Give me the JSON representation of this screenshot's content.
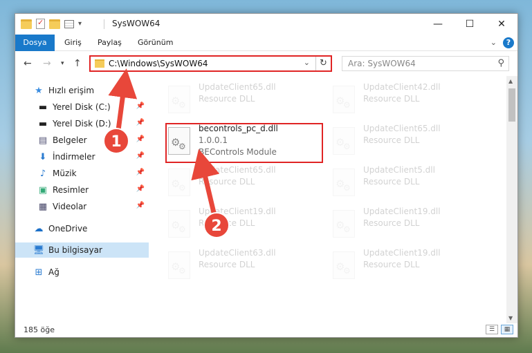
{
  "window": {
    "title": "SysWOW64"
  },
  "ribbon": {
    "tabs": [
      "Dosya",
      "Giriş",
      "Paylaş",
      "Görünüm"
    ]
  },
  "address": {
    "path": "C:\\Windows\\SysWOW64",
    "search_placeholder": "Ara: SysWOW64"
  },
  "sidebar": {
    "items": [
      {
        "label": "Hızlı erişim",
        "icon": "star-icon"
      },
      {
        "label": "Yerel Disk (C:)",
        "icon": "drive-icon",
        "pinned": true
      },
      {
        "label": "Yerel Disk (D:)",
        "icon": "drive-icon",
        "pinned": true
      },
      {
        "label": "Belgeler",
        "icon": "documents-icon",
        "pinned": true
      },
      {
        "label": "İndirmeler",
        "icon": "download-icon",
        "pinned": true
      },
      {
        "label": "Müzik",
        "icon": "music-icon",
        "pinned": true
      },
      {
        "label": "Resimler",
        "icon": "pictures-icon",
        "pinned": true
      },
      {
        "label": "Videolar",
        "icon": "videos-icon",
        "pinned": true
      },
      {
        "label": "OneDrive",
        "icon": "cloud-icon"
      },
      {
        "label": "Bu bilgisayar",
        "icon": "computer-icon",
        "selected": true
      },
      {
        "label": "Ağ",
        "icon": "network-icon"
      }
    ]
  },
  "files": [
    {
      "name": "UpdateClient65.dll",
      "line2": "Resource DLL",
      "faded": true
    },
    {
      "name": "UpdateClient42.dll",
      "line2": "Resource DLL",
      "faded": true
    },
    {
      "name": "becontrols_pc_d.dll",
      "line2": "1.0.0.1",
      "line3": "BEControls Module",
      "faded": false
    },
    {
      "name": "UpdateClient65.dll",
      "line2": "Resource DLL",
      "faded": true
    },
    {
      "name": "UpdateClient65.dll",
      "line2": "Resource DLL",
      "faded": true
    },
    {
      "name": "UpdateClient5.dll",
      "line2": "Resource DLL",
      "faded": true
    },
    {
      "name": "UpdateClient19.dll",
      "line2": "Resource DLL",
      "faded": true
    },
    {
      "name": "UpdateClient19.dll",
      "line2": "Resource DLL",
      "faded": true
    },
    {
      "name": "UpdateClient63.dll",
      "line2": "Resource DLL",
      "faded": true
    },
    {
      "name": "UpdateClient19.dll",
      "line2": "Resource DLL",
      "faded": true
    }
  ],
  "status": {
    "count": "185 öğe"
  },
  "annotations": {
    "step1": "1",
    "step2": "2"
  },
  "colors": {
    "accent": "#1979ca",
    "annotation": "#e02424"
  }
}
